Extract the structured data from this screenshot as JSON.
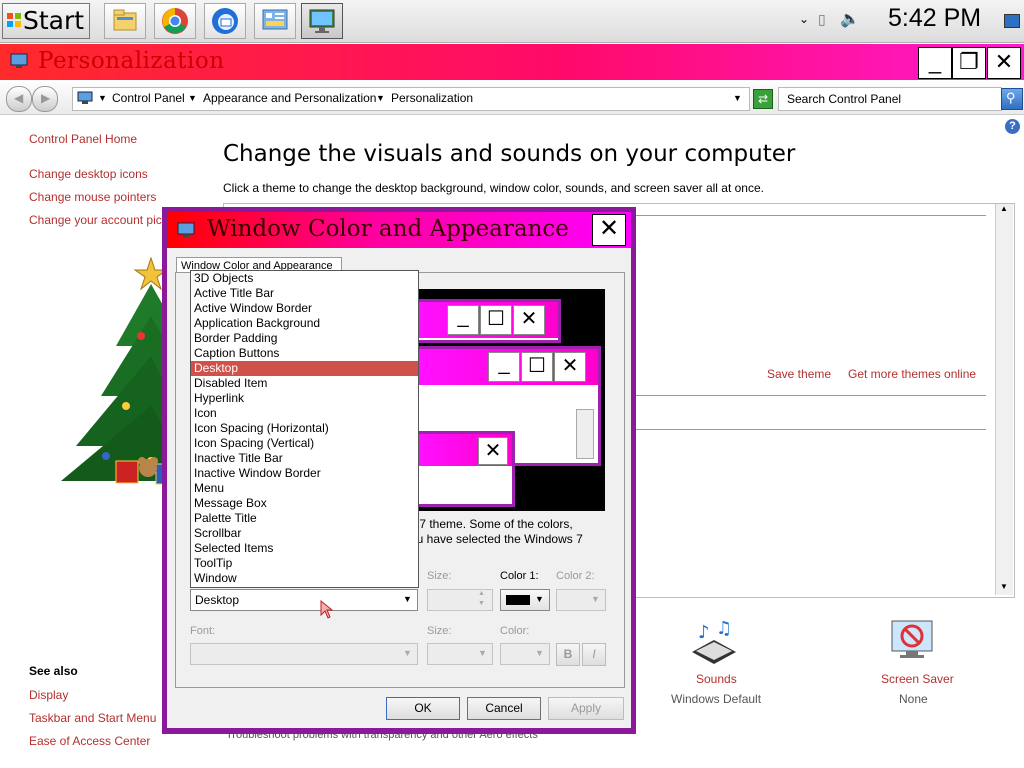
{
  "taskbar": {
    "start_label": "Start",
    "clock": "5:42 PM",
    "apps": [
      "explorer-icon",
      "chrome-icon",
      "thunderbird-icon",
      "control-panel-icon",
      "personalization-icon"
    ]
  },
  "window": {
    "title": "Personalization",
    "breadcrumb": [
      "Control Panel",
      "Appearance and Personalization",
      "Personalization"
    ],
    "search_placeholder": "Search Control Panel"
  },
  "sidebar": {
    "home": "Control Panel Home",
    "links": [
      "Change desktop icons",
      "Change mouse pointers",
      "Change your account pic"
    ],
    "see_also_title": "See also",
    "see_also": [
      "Display",
      "Taskbar and Start Menu",
      "Ease of Access Center"
    ]
  },
  "main": {
    "heading": "Change the visuals and sounds on your computer",
    "description": "Click a theme to change the desktop background, window color, sounds, and screen saver all at once.",
    "save_theme": "Save theme",
    "get_more": "Get more themes online",
    "sounds_label": "Sounds",
    "sounds_value": "Windows Default",
    "screensaver_label": "Screen Saver",
    "screensaver_value": "None",
    "troubleshoot": "Troubleshoot problems with transparency and other Aero effects"
  },
  "dialog": {
    "title": "Window Color and Appearance",
    "tab": "Window Color and Appearance",
    "info_line1": "s 7 theme.  Some of the colors,",
    "info_line2": "ou have selected the Windows 7",
    "item_options": [
      "3D Objects",
      "Active Title Bar",
      "Active Window Border",
      "Application Background",
      "Border Padding",
      "Caption Buttons",
      "Desktop",
      "Disabled Item",
      "Hyperlink",
      "Icon",
      "Icon Spacing (Horizontal)",
      "Icon Spacing (Vertical)",
      "Inactive Title Bar",
      "Inactive Window Border",
      "Menu",
      "Message Box",
      "Palette Title",
      "Scrollbar",
      "Selected Items",
      "ToolTip",
      "Window"
    ],
    "selected_item": "Desktop",
    "size_label": "Size:",
    "color1_label": "Color 1:",
    "color2_label": "Color 2:",
    "font_label": "Font:",
    "font_size_label": "Size:",
    "font_color_label": "Color:",
    "bold_label": "B",
    "italic_label": "I",
    "ok_label": "OK",
    "cancel_label": "Cancel",
    "apply_label": "Apply",
    "color1_value": "#000000"
  },
  "colors": {
    "title_gradient_start": "#ff2a2a",
    "title_gradient_end": "#ff1ad0",
    "link": "#b3302f",
    "selection": "#d0504a",
    "dialog_border": "#8a1a9a"
  }
}
